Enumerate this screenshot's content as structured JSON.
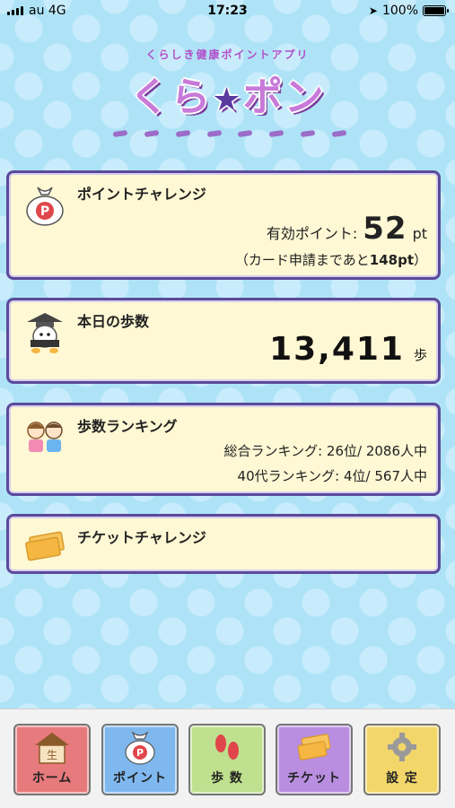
{
  "status": {
    "carrier": "au 4G",
    "time": "17:23",
    "battery": "100%"
  },
  "header": {
    "subtitle": "くらしき健康ポイントアプリ",
    "logo_left": "くら",
    "logo_star": "★",
    "logo_right": "ポン"
  },
  "points_card": {
    "title": "ポイントチャレンジ",
    "label": "有効ポイント:",
    "value": "52",
    "unit": "pt",
    "note_prefix": "（カード申請まであと",
    "note_value": "148pt",
    "note_suffix": "）"
  },
  "steps_card": {
    "title": "本日の歩数",
    "value": "13,411",
    "unit": "歩"
  },
  "ranking_card": {
    "title": "歩数ランキング",
    "overall": "総合ランキング: 26位/ 2086人中",
    "age": "40代ランキング: 4位/ 567人中"
  },
  "ticket_card": {
    "title": "チケットチャレンジ"
  },
  "tabs": [
    {
      "label": "ホーム",
      "color": "#e77a7c"
    },
    {
      "label": "ポイント",
      "color": "#7fb8ef"
    },
    {
      "label": "歩 数",
      "color": "#bfe08e"
    },
    {
      "label": "チケット",
      "color": "#b98ee0"
    },
    {
      "label": "設 定",
      "color": "#f2d66a"
    }
  ],
  "icon_text": {
    "points_badge": "P",
    "home_kanji": "生"
  }
}
